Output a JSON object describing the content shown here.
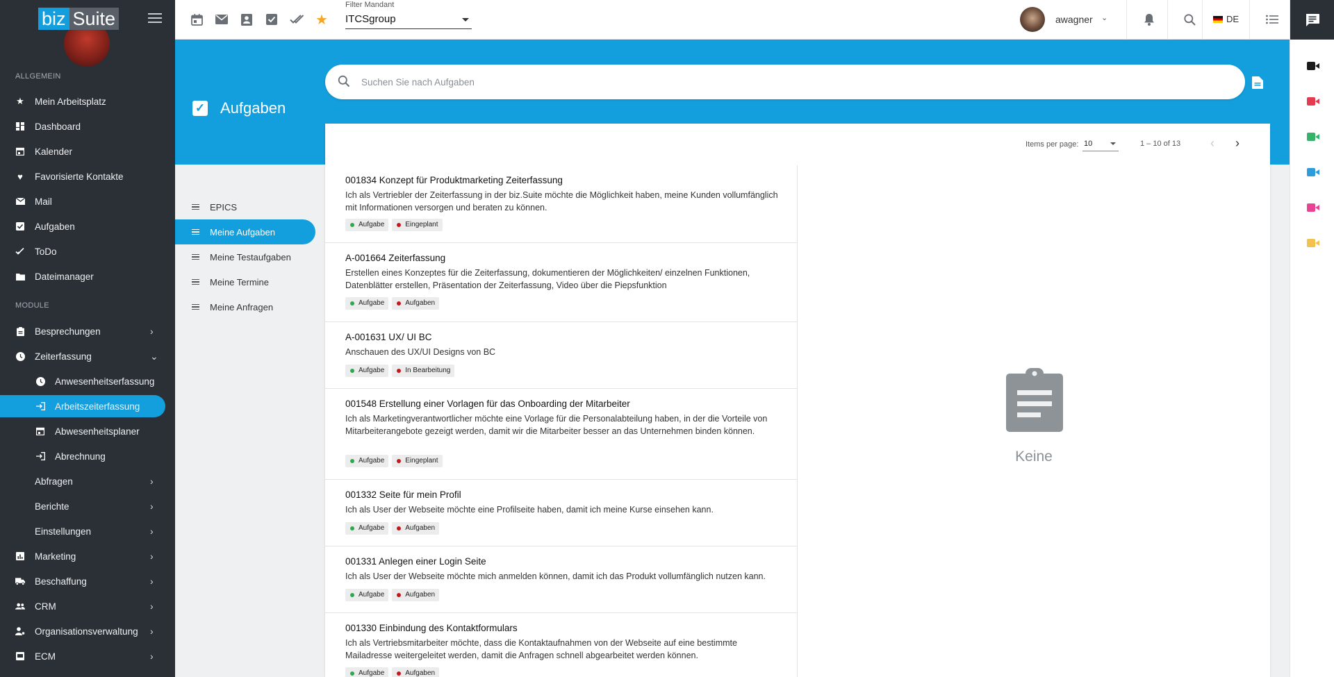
{
  "app": {
    "logo_left": "biz",
    "logo_right": "Suite"
  },
  "sidebar": {
    "section_general": "ALLGEMEIN",
    "section_modules": "MODULE",
    "general_items": [
      {
        "label": "Mein Arbeitsplatz",
        "icon": "star-icon"
      },
      {
        "label": "Dashboard",
        "icon": "dashboard-icon"
      },
      {
        "label": "Kalender",
        "icon": "calendar-icon"
      },
      {
        "label": "Favorisierte Kontakte",
        "icon": "heart-icon"
      },
      {
        "label": "Mail",
        "icon": "mail-icon"
      },
      {
        "label": "Aufgaben",
        "icon": "checkbox-icon"
      },
      {
        "label": "ToDo",
        "icon": "double-check-icon"
      },
      {
        "label": "Dateimanager",
        "icon": "folder-icon"
      }
    ],
    "module_items": {
      "besprechungen": "Besprechungen",
      "zeiterfassung": "Zeiterfassung",
      "anwesenheitserfassung": "Anwesenheitserfassung",
      "arbeitszeiterfassung": "Arbeitszeiterfassung",
      "abwesenheitsplaner": "Abwesenheitsplaner",
      "abrechnung": "Abrechnung",
      "abfragen": "Abfragen",
      "berichte": "Berichte",
      "einstellungen": "Einstellungen",
      "marketing": "Marketing",
      "beschaffung": "Beschaffung",
      "crm": "CRM",
      "organisationsverwaltung": "Organisationsverwaltung",
      "ecm": "ECM"
    }
  },
  "topbar": {
    "filter_label": "Filter Mandant",
    "filter_value": "ITCSgroup",
    "username": "awagner",
    "language": "DE"
  },
  "page": {
    "title": "Aufgaben",
    "search_placeholder": "Suchen Sie nach Aufgaben",
    "empty_text": "Keine"
  },
  "subnav": [
    "EPICS",
    "Meine Aufgaben",
    "Meine Testaufgaben",
    "Meine Termine",
    "Meine Anfragen"
  ],
  "paginator": {
    "items_per_page_label": "Items per page:",
    "items_per_page": "10",
    "range": "1 – 10 of 13"
  },
  "tasks": [
    {
      "title": "001834 Konzept für Produktmarketing Zeiterfassung",
      "desc": "Ich als Vertriebler der Zeiterfassung in der biz.Suite möchte die Möglichkeit haben, meine Kunden vollumfänglich mit Informationen versorgen und beraten zu können.",
      "type": "Aufgabe",
      "status": "Eingeplant"
    },
    {
      "title": "A-001664 Zeiterfassung",
      "desc": "Erstellen eines Konzeptes für die Zeiterfassung, dokumentieren der Möglichkeiten/ einzelnen Funktionen, Datenblätter erstellen, Präsentation der Zeiterfassung, Video über die Piepsfunktion",
      "type": "Aufgabe",
      "status": "Aufgaben"
    },
    {
      "title": "A-001631 UX/ UI BC",
      "desc": "Anschauen des UX/UI Designs von BC",
      "type": "Aufgabe",
      "status": "In Bearbeitung"
    },
    {
      "title": "001548 Erstellung einer Vorlagen für das Onboarding der Mitarbeiter",
      "desc": "Ich als Marketingverantwortlicher möchte eine Vorlage für die Personalabteilung haben, in der die Vorteile von Mitarbeiterangebote gezeigt werden, damit wir die Mitarbeiter besser an das Unternehmen binden können.",
      "type": "Aufgabe",
      "status": "Eingeplant"
    },
    {
      "title": "001332 Seite für mein Profil",
      "desc": "Ich als User der Webseite möchte eine Profilseite haben, damit ich meine Kurse einsehen kann.",
      "type": "Aufgabe",
      "status": "Aufgaben"
    },
    {
      "title": "001331 Anlegen einer Login Seite",
      "desc": "Ich als User der Webseite möchte mich anmelden können, damit ich das Produkt vollumfänglich nutzen kann.",
      "type": "Aufgabe",
      "status": "Aufgaben"
    },
    {
      "title": "001330 Einbindung des Kontaktformulars",
      "desc": "Ich als Vertriebsmitarbeiter möchte, dass die Kontaktaufnahmen von der Webseite auf eine bestimmte Mailadresse weitergeleitet werden, damit die Anfragen schnell abgearbeitet werden können.",
      "type": "Aufgabe",
      "status": "Aufgaben"
    }
  ],
  "colors": {
    "accent": "#139fde",
    "sidebar_bg": "#2b3036",
    "tag_green": "#2fa84f",
    "tag_red": "#c8161d",
    "star": "#f5a623"
  },
  "rail_cams": [
    "#1b1b1b",
    "#e53950",
    "#36b36a",
    "#2d9cdb",
    "#e84393",
    "#f2c14e"
  ]
}
